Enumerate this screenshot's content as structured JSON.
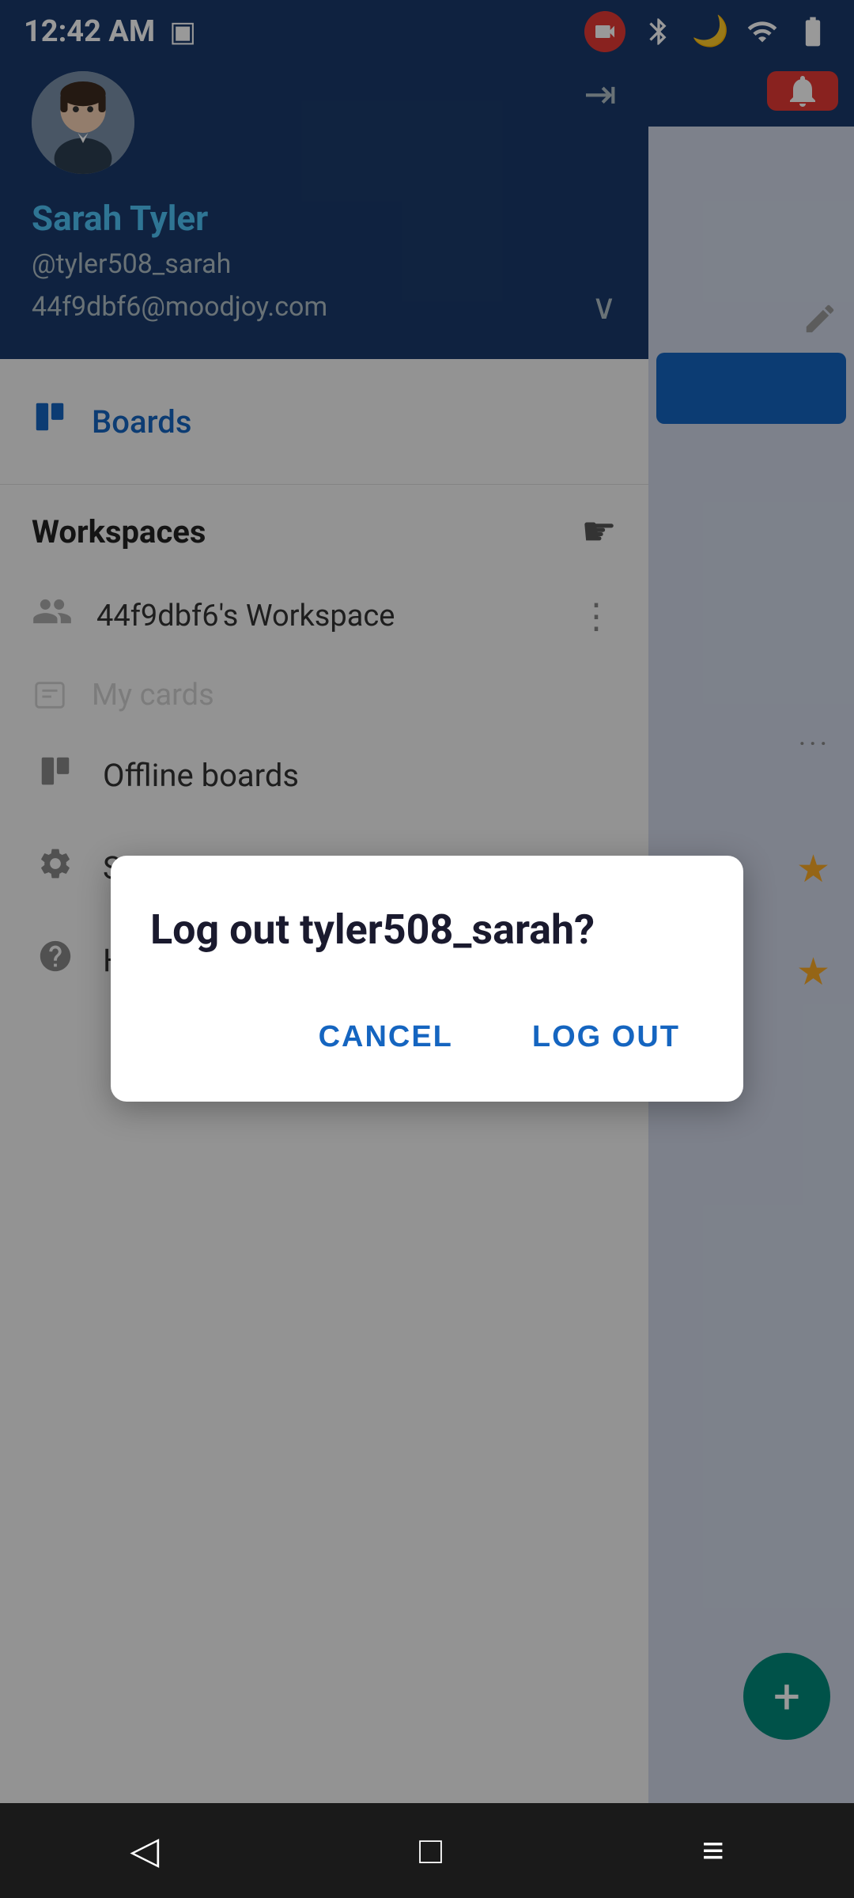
{
  "statusBar": {
    "time": "12:42 AM",
    "icons": {
      "camera": "📷",
      "bluetooth": "⬡",
      "moon": "🌙",
      "wifi": "▲",
      "battery": "▮"
    }
  },
  "sidebar": {
    "user": {
      "name": "Sarah Tyler",
      "handle": "@tyler508_sarah",
      "email": "44f9dbf6@moodjoy.com"
    },
    "boards": {
      "label": "Boards",
      "icon": "⊞"
    },
    "workspaces": {
      "title": "Workspaces",
      "items": [
        {
          "name": "44f9dbf6's Workspace"
        }
      ]
    },
    "menuItems": [
      {
        "label": "My cards",
        "icon": "⊡"
      },
      {
        "label": "Offline boards",
        "icon": "⊞"
      },
      {
        "label": "Settings",
        "icon": "⚙"
      },
      {
        "label": "Help!",
        "icon": "ℹ"
      }
    ]
  },
  "dialog": {
    "title": "Log out tyler508_sarah?",
    "cancelLabel": "CANCEL",
    "logoutLabel": "LOG OUT"
  },
  "navbar": {
    "backLabel": "◁",
    "homeLabel": "□",
    "menuLabel": "≡"
  }
}
